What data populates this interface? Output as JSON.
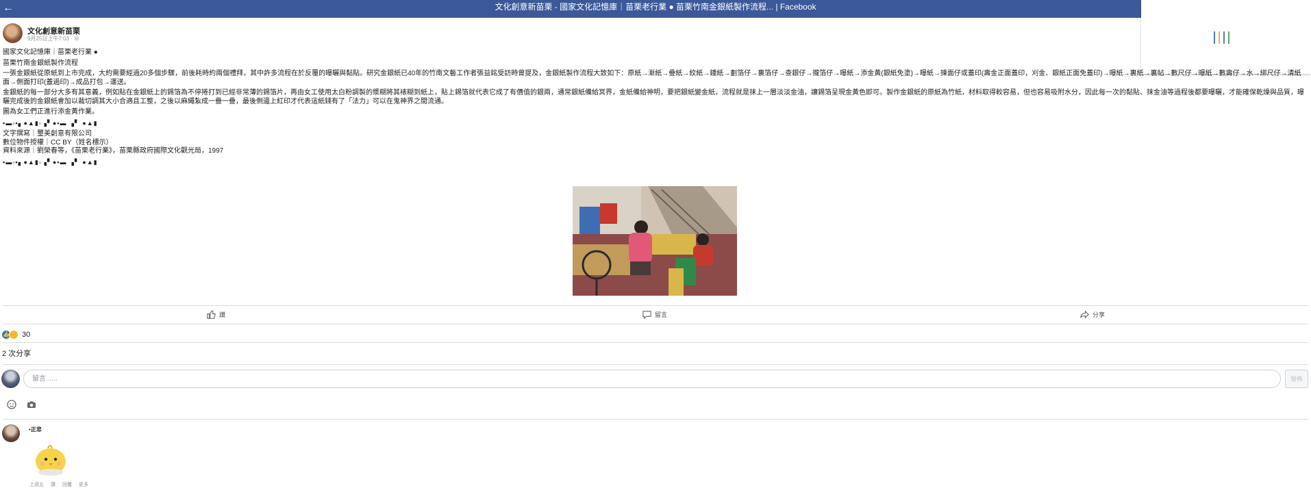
{
  "topbar": {
    "back_icon": "back-arrow-icon",
    "title": "文化創意新苗栗 - 國家文化記憶庫｜苗栗老行業 ● 苗栗竹南金銀紙製作流程... | Facebook"
  },
  "post": {
    "page_name": "文化創意新苗栗",
    "date": "9月25日上午7:03 · ",
    "lines": [
      "國家文化記憶庫｜苗栗老行業 ●",
      "苗栗竹南金銀紙製作流程",
      "一張金銀紙從原紙到上市完成，大約需要經過20多個步驟，前後耗時約兩個禮拜，其中許多流程在於反覆的曝曬與黏貼。研究金銀紙已40年的竹南文藝工作者張益銘受訪時曾提及，金銀紙製作流程大致如下：原紙→漸紙→疊紙→紋紙→鍾紙→劃箔仔→裏箔仔→查銀仔→攏箔仔→曝紙→添金黃(銀紙免塗)→曝紙→揀面仔或蓋印(壽金正面蓋印，刈金、銀紙正面免蓋印)→曝紙→裏紙→裏帖→數尺仔→曝紙→數壽仔→水→綁尺仔→清紙面→側面打印(蓋過印)→成品打包→運送。",
      "金銀紙的每一部分大多有其意義，例如貼在金銀紙上的錫箔為不停捲打到已經非常薄的錫箔片，再由女工使用太白粉調製的漿糊將其裱糊到紙上，貼上錫箔就代表它成了有價值的銀兩，通常銀紙備給冥界，金紙備給神明，要把銀紙變金紙，流程就是抹上一層淡淡金油，讓錫箔呈現金黃色即可。製作金銀紙的原紙為竹紙，材料取得較容易，但也容易吸附水分，因此每一次的黏貼、抹金油等過程後都要曝曬，才能確保乾燥與品質，曝曬完成後的金銀紙會加以裁切調其大小合適且工整，之後以麻繩紮成一疊一疊，最後側邊上紅印才代表這紙錢有了「法力」可以在鬼神界之間流通。",
      "圖為女工們正進行添金黃作業。",
      "文字撰寫｜璽美創意有限公司",
      "數位物件授權｜CC BY（姓名標示）",
      "資料來源｜劉榮春等，《苗栗老行業》，苗栗縣政府國際文化觀光局，1997",
      "▪▬▫▪▖●▲▮▫▗▘●▪▬ ▗▘ ●▲▮"
    ],
    "photo_caption_icon": "photo-women-workers"
  },
  "actions": {
    "like": "讚",
    "comment": "留言",
    "share": "分享"
  },
  "stats": {
    "reaction_count": "30",
    "shares": "2 次分享"
  },
  "composer": {
    "placeholder": "留言......",
    "post_button": "發佈"
  },
  "comment": {
    "author": "▪正忠",
    "meta": [
      "上週五",
      "讚",
      "回覆",
      "更多"
    ]
  }
}
